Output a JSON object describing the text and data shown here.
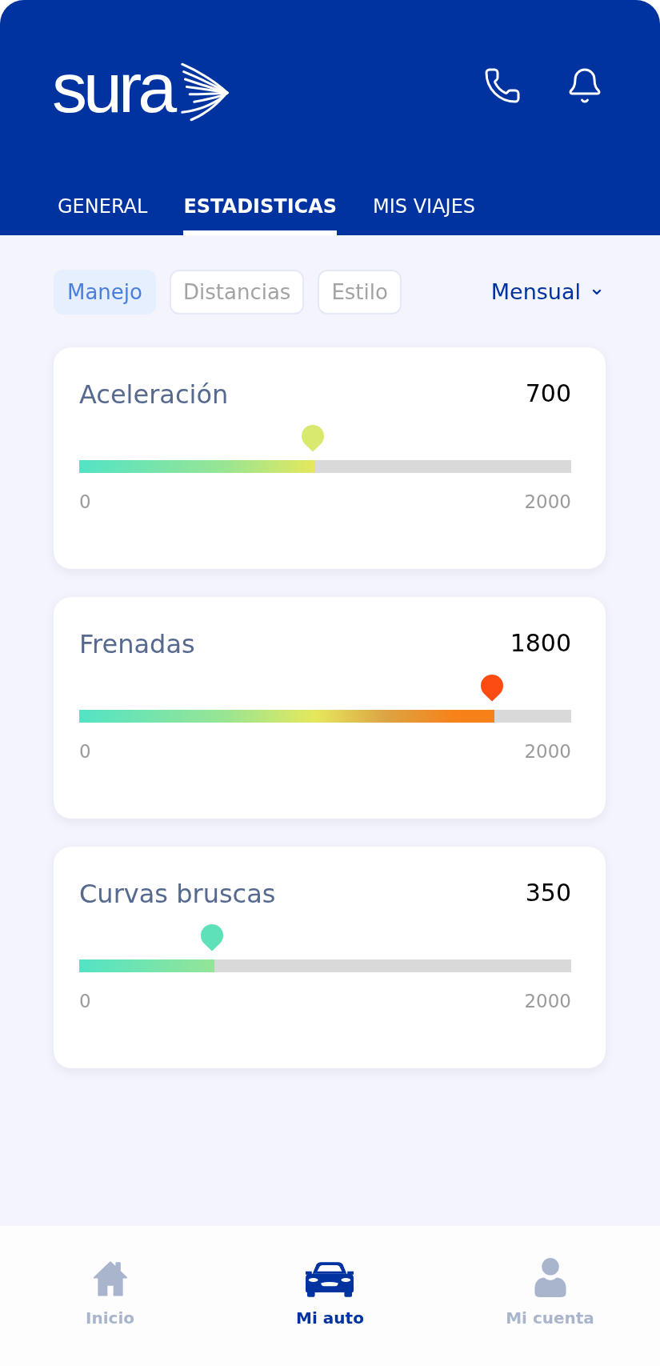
{
  "header": {
    "logo": {
      "text": "sura"
    },
    "tabs": [
      {
        "label": "GENERAL",
        "selected": false
      },
      {
        "label": "ESTADISTICAS",
        "selected": true
      },
      {
        "label": "MIS VIAJES",
        "selected": false
      }
    ]
  },
  "filters": {
    "chips": [
      {
        "label": "Manejo",
        "selected": true
      },
      {
        "label": "Distancias",
        "selected": false
      },
      {
        "label": "Estilo",
        "selected": false
      }
    ],
    "period": {
      "value": "Mensual"
    }
  },
  "metrics": [
    {
      "title": "Aceleración",
      "value": "700",
      "level": 0.48,
      "color": "#d9e86f",
      "min": "0",
      "max": "2000"
    },
    {
      "title": "Frenadas",
      "value": "1800",
      "level": 0.844,
      "color": "#fc4c12",
      "min": "0",
      "max": "2000"
    },
    {
      "title": "Curvas bruscas",
      "value": "350",
      "level": 0.275,
      "color": "#5ee0b8",
      "min": "0",
      "max": "2000"
    }
  ],
  "bottom_nav": [
    {
      "label": "Inicio",
      "selected": false
    },
    {
      "label": "Mi auto",
      "selected": true
    },
    {
      "label": "Mi cuenta",
      "selected": false
    }
  ]
}
